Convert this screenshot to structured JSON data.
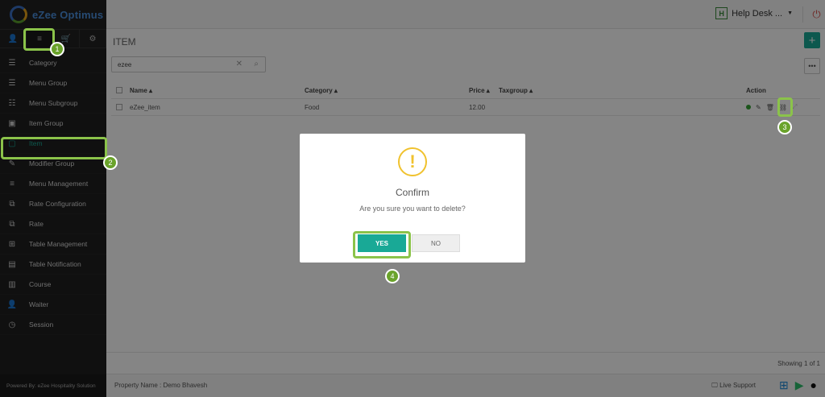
{
  "app": {
    "logo_text": "eZee Optimus"
  },
  "sidebar": {
    "tabs": [
      {
        "icon": "user-icon",
        "glyph": "👤"
      },
      {
        "icon": "menu-icon",
        "glyph": "≡"
      },
      {
        "icon": "cart-icon",
        "glyph": "🛒"
      },
      {
        "icon": "gear-icon",
        "glyph": "⚙"
      }
    ],
    "items": [
      {
        "label": "Category",
        "icon": "category-icon",
        "glyph": "☰"
      },
      {
        "label": "Menu Group",
        "icon": "list-icon",
        "glyph": "☰"
      },
      {
        "label": "Menu Subgroup",
        "icon": "sublist-icon",
        "glyph": "☷"
      },
      {
        "label": "Item Group",
        "icon": "box-icon",
        "glyph": "▣"
      },
      {
        "label": "Item",
        "icon": "item-icon",
        "glyph": "▢"
      },
      {
        "label": "Modifier Group",
        "icon": "edit-icon",
        "glyph": "✎"
      },
      {
        "label": "Menu Management",
        "icon": "menu-icon",
        "glyph": "≡"
      },
      {
        "label": "Rate Configuration",
        "icon": "rate-config-icon",
        "glyph": "⧉"
      },
      {
        "label": "Rate",
        "icon": "rate-icon",
        "glyph": "⧉"
      },
      {
        "label": "Table Management",
        "icon": "table-icon",
        "glyph": "⊞"
      },
      {
        "label": "Table Notification",
        "icon": "notification-icon",
        "glyph": "▤"
      },
      {
        "label": "Course",
        "icon": "course-icon",
        "glyph": "▥"
      },
      {
        "label": "Waiter",
        "icon": "waiter-icon",
        "glyph": "👤"
      },
      {
        "label": "Session",
        "icon": "clock-icon",
        "glyph": "◷"
      }
    ],
    "footer": "Powered By: eZee Hospitality Solution"
  },
  "topbar": {
    "helpdesk_badge": "H",
    "helpdesk_label": "Help Desk ...",
    "caret": "▼",
    "power_glyph": "⏻"
  },
  "page": {
    "title": "ITEM",
    "add_glyph": "+",
    "more_glyph": "•••",
    "search_value": "ezee",
    "search_clear_glyph": "✕",
    "search_glyph": "⌕"
  },
  "table": {
    "columns": [
      "Name ▴",
      "Category ▴",
      "Price ▴",
      "Taxgroup ▴",
      "Action"
    ],
    "rows": [
      {
        "name": "eZee_item",
        "category": "Food",
        "price": "12.00",
        "taxgroup": ""
      }
    ],
    "action_glyphs": {
      "edit": "✎",
      "delete": "🗑",
      "link": "⛓",
      "expand": "⤢"
    }
  },
  "status": {
    "showing": "Showing 1 of 1"
  },
  "bottombar": {
    "property": "Property Name : Demo Bhavesh",
    "live_support": "🖵 Live Support"
  },
  "modal": {
    "icon_glyph": "!",
    "title": "Confirm",
    "message": "Are you sure you want to delete?",
    "yes_label": "YES",
    "no_label": "NO"
  },
  "steps": [
    "1",
    "2",
    "3",
    "4"
  ],
  "colors": {
    "accent": "#19a996",
    "highlight": "#8bc34a",
    "sidebar": "#1f1f1f",
    "warning": "#f0c22e"
  }
}
